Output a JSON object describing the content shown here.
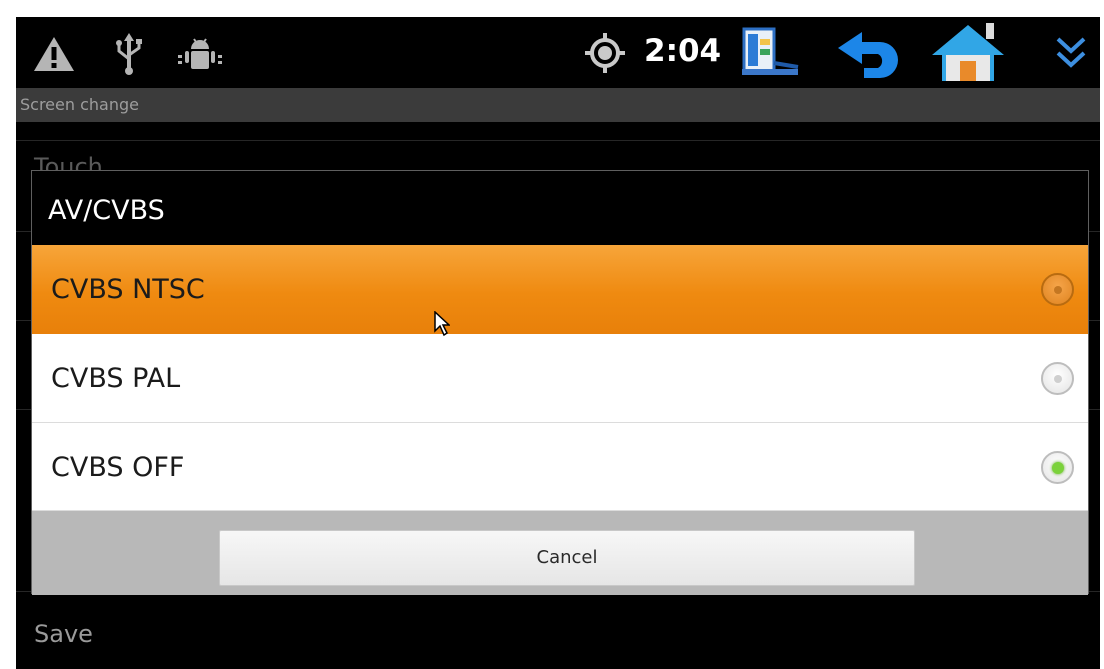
{
  "status_bar": {
    "time": "2:04",
    "left_icons": [
      "warning-icon",
      "usb-icon",
      "android-debug-icon"
    ],
    "right_icons": [
      "gps-icon",
      "task-manager-icon",
      "back-icon",
      "home-icon",
      "expand-icon"
    ]
  },
  "screen": {
    "subtitle": "Screen change",
    "bg_item_partial": "Touch",
    "save_label": "Save"
  },
  "dialog": {
    "title": "AV/CVBS",
    "options": [
      {
        "label": "CVBS NTSC",
        "highlighted": true,
        "checked": false
      },
      {
        "label": "CVBS PAL",
        "highlighted": false,
        "checked": false
      },
      {
        "label": "CVBS OFF",
        "highlighted": false,
        "checked": true
      }
    ],
    "cancel_label": "Cancel"
  },
  "colors": {
    "highlight": "#ef8a10",
    "radio_checked": "#7bd23a",
    "back_arrow": "#1c86e8",
    "home": "#31a6e6"
  }
}
